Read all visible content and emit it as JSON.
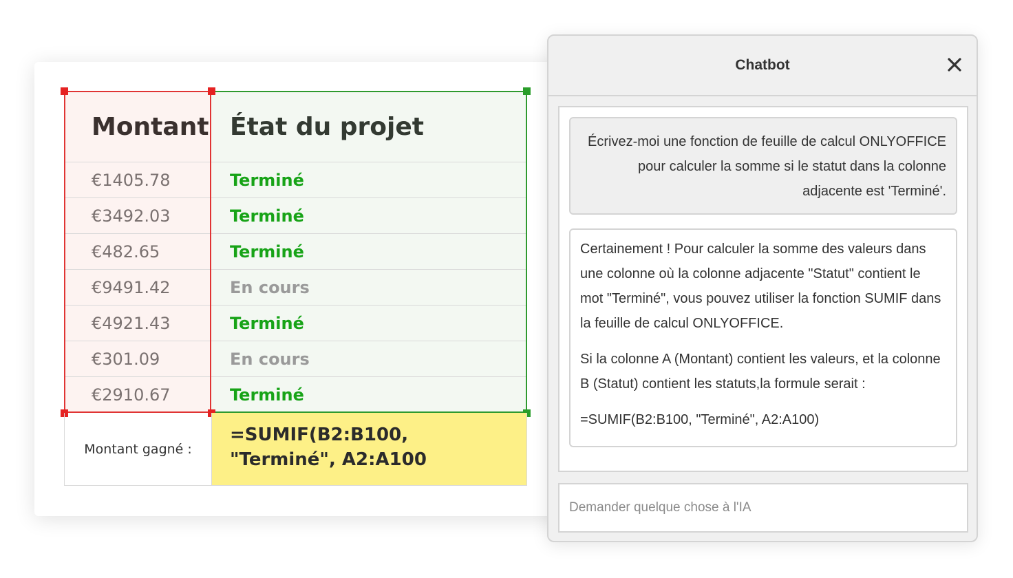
{
  "spreadsheet": {
    "header": {
      "amount": "Montant",
      "status": "État du projet"
    },
    "rows": [
      {
        "amount": "€1405.78",
        "status": "Terminé",
        "status_color": "#17a317"
      },
      {
        "amount": "€3492.03",
        "status": "Terminé",
        "status_color": "#17a317"
      },
      {
        "amount": "€482.65",
        "status": "Terminé",
        "status_color": "#17a317"
      },
      {
        "amount": "€9491.42",
        "status": "En cours",
        "status_color": "#9a9a9a"
      },
      {
        "amount": "€4921.43",
        "status": "Terminé",
        "status_color": "#17a317"
      },
      {
        "amount": "€301.09",
        "status": "En cours",
        "status_color": "#9a9a9a"
      },
      {
        "amount": "€2910.67",
        "status": "Terminé",
        "status_color": "#17a317"
      }
    ],
    "footer": {
      "label": "Montant gagné :",
      "formula": "=SUMIF(B2:B100, \"Terminé\", A2:A100"
    },
    "colors": {
      "amount_selection": "#e03434",
      "status_selection": "#2f9a2f",
      "formula_highlight": "#fdf087"
    }
  },
  "chatbot": {
    "title": "Chatbot",
    "close_icon": "close-icon",
    "messages": {
      "user": "Écrivez-moi une fonction de feuille de calcul ONLYOFFICE pour calculer la somme si le statut dans la colonne adjacente est 'Terminé'.",
      "bot_paragraph_1": "Certainement ! Pour calculer la somme des valeurs dans une colonne où la colonne adjacente \"Statut\" contient le mot \"Terminé\", vous pouvez utiliser la fonction SUMIF dans la feuille de calcul ONLYOFFICE.",
      "bot_paragraph_2": "Si la colonne A (Montant) contient les valeurs, et la colonne B (Statut) contient les statuts,la formule serait :",
      "bot_paragraph_3": "=SUMIF(B2:B100, \"Terminé\", A2:A100)"
    },
    "input_placeholder": "Demander quelque chose à l'IA"
  }
}
